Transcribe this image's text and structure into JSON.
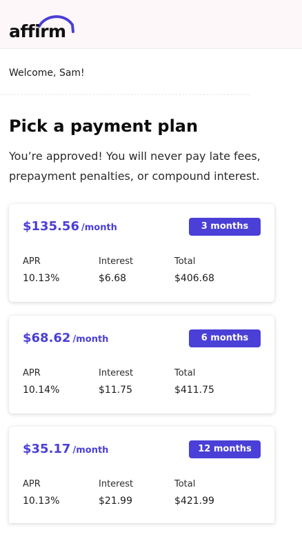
{
  "header": {
    "logo_text": "affirm"
  },
  "welcome": "Welcome, Sam!",
  "title": "Pick a payment plan",
  "subtitle": "You’re approved! You will never pay late fees, prepayment penalties, or compound interest.",
  "labels": {
    "apr": "APR",
    "interest": "Interest",
    "total": "Total"
  },
  "colors": {
    "accent": "#4a3fd6"
  },
  "plans": [
    {
      "amount": "$135.56",
      "per": "/month",
      "term": "3 months",
      "apr": "10.13%",
      "interest": "$6.68",
      "total": "$406.68"
    },
    {
      "amount": "$68.62",
      "per": "/month",
      "term": "6 months",
      "apr": "10.14%",
      "interest": "$11.75",
      "total": "$411.75"
    },
    {
      "amount": "$35.17",
      "per": "/month",
      "term": "12 months",
      "apr": "10.13%",
      "interest": "$21.99",
      "total": "$421.99"
    }
  ]
}
